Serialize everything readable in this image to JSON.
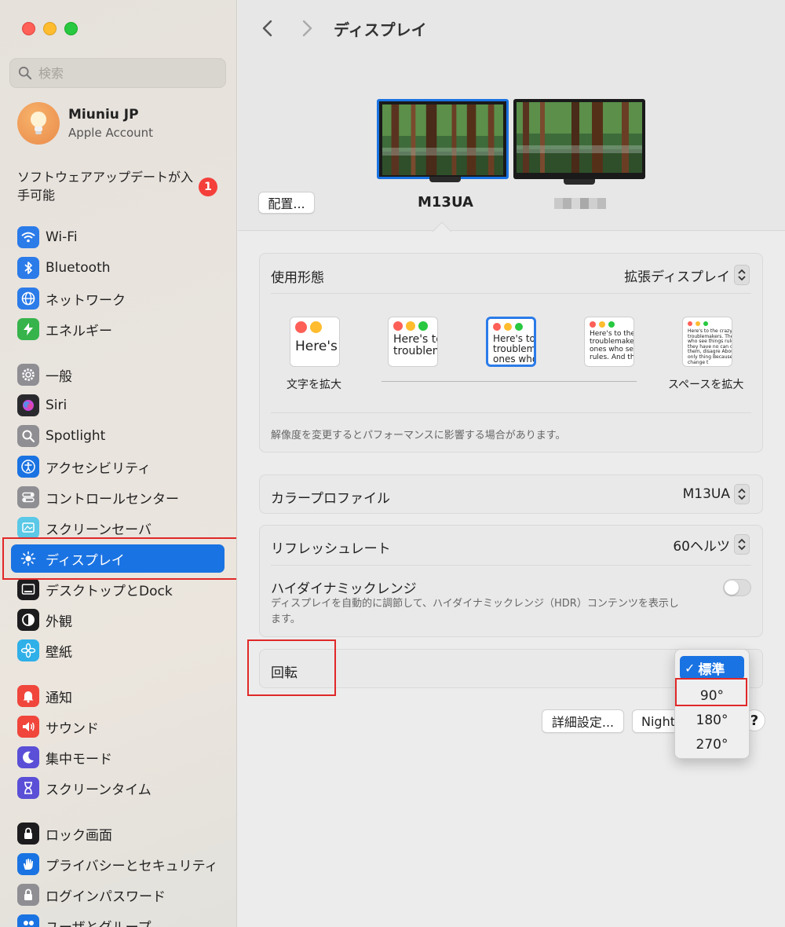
{
  "window": {
    "title": "ディスプレイ"
  },
  "search": {
    "placeholder": "検索"
  },
  "account": {
    "name": "Miuniu JP",
    "subtitle": "Apple Account"
  },
  "update": {
    "text": "ソフトウェアアップデートが入手可能",
    "badge": "1"
  },
  "sidebar": {
    "items": [
      {
        "label": "Wi-Fi",
        "icon": "wifi-icon",
        "color": "#2b7be9"
      },
      {
        "label": "Bluetooth",
        "icon": "bluetooth-icon",
        "color": "#2b7be9"
      },
      {
        "label": "ネットワーク",
        "icon": "globe-icon",
        "color": "#2b7be9"
      },
      {
        "label": "エネルギー",
        "icon": "bolt-icon",
        "color": "#36b34a"
      },
      {
        "label": "一般",
        "icon": "gear-icon",
        "color": "#8e8e93"
      },
      {
        "label": "Siri",
        "icon": "siri-icon",
        "color": "#2a2a2e"
      },
      {
        "label": "Spotlight",
        "icon": "magnifier-icon",
        "color": "#8e8e93"
      },
      {
        "label": "アクセシビリティ",
        "icon": "accessibility-icon",
        "color": "#1a73e2"
      },
      {
        "label": "コントロールセンター",
        "icon": "switches-icon",
        "color": "#8e8e93"
      },
      {
        "label": "スクリーンセーバ",
        "icon": "screensaver-icon",
        "color": "#5ac8e6"
      },
      {
        "label": "ディスプレイ",
        "icon": "sun-icon",
        "color": "#1a73e2"
      },
      {
        "label": "デスクトップとDock",
        "icon": "dock-icon",
        "color": "#1c1c1e"
      },
      {
        "label": "外観",
        "icon": "appearance-icon",
        "color": "#1c1c1e"
      },
      {
        "label": "壁紙",
        "icon": "flower-icon",
        "color": "#2fb0e8"
      },
      {
        "label": "通知",
        "icon": "bell-icon",
        "color": "#f0463c"
      },
      {
        "label": "サウンド",
        "icon": "speaker-icon",
        "color": "#f0463c"
      },
      {
        "label": "集中モード",
        "icon": "moon-icon",
        "color": "#5a4fd6"
      },
      {
        "label": "スクリーンタイム",
        "icon": "hourglass-icon",
        "color": "#5a4fd6"
      },
      {
        "label": "ロック画面",
        "icon": "lock-icon",
        "color": "#1c1c1e"
      },
      {
        "label": "プライバシーとセキュリティ",
        "icon": "hand-icon",
        "color": "#1a73e2"
      },
      {
        "label": "ログインパスワード",
        "icon": "padlock-icon",
        "color": "#8e8e93"
      },
      {
        "label": "ユーザとグループ",
        "icon": "users-icon",
        "color": "#1a73e2"
      }
    ]
  },
  "displays": {
    "arrange_button": "配置...",
    "primary_name": "M13UA"
  },
  "usage": {
    "label": "使用形態",
    "value": "拡張ディスプレイ",
    "options": [
      {
        "sample": "Here's"
      },
      {
        "sample": "Here's to troublem"
      },
      {
        "sample": "Here's to t troublema ones who"
      },
      {
        "sample": "Here's to the cr troublemakers. ones who see t rules. And they"
      },
      {
        "sample": "Here's to the crazy one troublemakers. The ones who see things rules. And they have no can quote them, disagre About the only thing Because they change t"
      }
    ],
    "left_caption": "文字を拡大",
    "right_caption": "スペースを拡大",
    "note": "解像度を変更するとパフォーマンスに影響する場合があります。"
  },
  "color_profile": {
    "label": "カラープロファイル",
    "value": "M13UA"
  },
  "refresh": {
    "label": "リフレッシュレート",
    "value": "60ヘルツ"
  },
  "hdr": {
    "label": "ハイダイナミックレンジ",
    "description": "ディスプレイを自動的に調節して、ハイダイナミックレンジ（HDR）コンテンツを表示します。"
  },
  "rotation": {
    "label": "回転",
    "options": [
      "標準",
      "90°",
      "180°",
      "270°"
    ]
  },
  "buttons": {
    "advanced": "詳細設定...",
    "night": "Night",
    "help": "?"
  },
  "colors": {
    "accent": "#1a73e2",
    "highlight": "#e02828"
  }
}
